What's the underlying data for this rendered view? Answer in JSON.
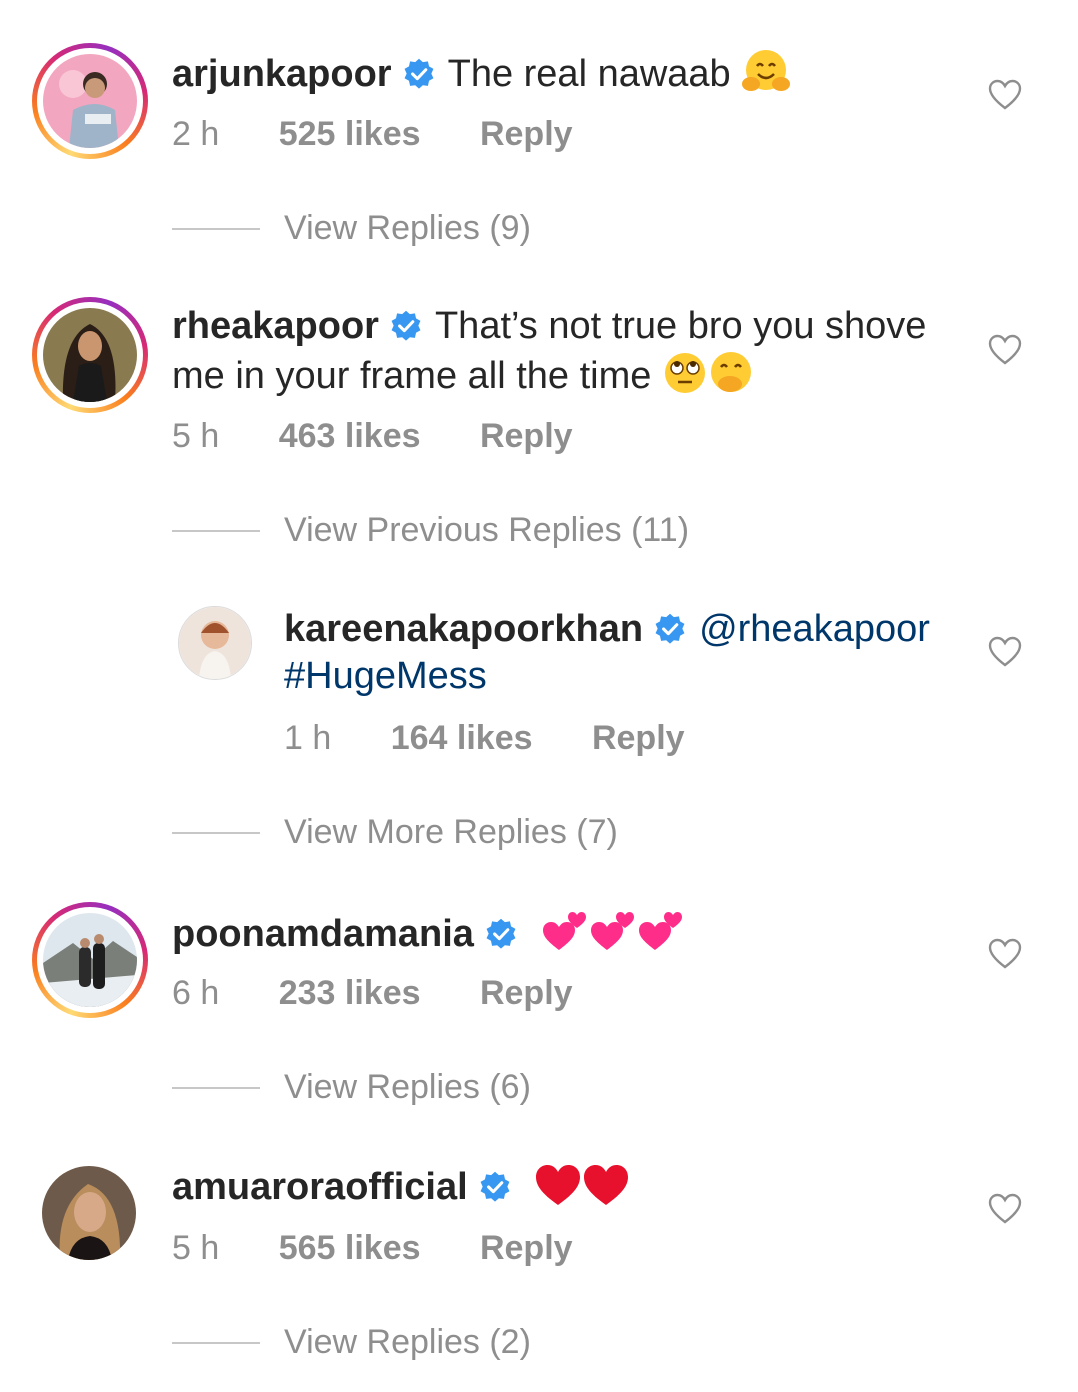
{
  "comments": [
    {
      "username": "arjunkapoor",
      "text": "The real nawaab",
      "time": "2 h",
      "likes": "525 likes",
      "reply": "Reply",
      "replies": "View Replies (9)"
    },
    {
      "username": "rheakapoor",
      "text_line1": "That’s not true bro you shove",
      "text_line2": "me in your frame all the time",
      "time": "5 h",
      "likes": "463 likes",
      "reply": "Reply",
      "replies": "View Previous Replies (11)"
    },
    {
      "username": "kareenakapoorkhan",
      "mention": "@rheakapoor",
      "hashtag": "#HugeMess",
      "time": "1 h",
      "likes": "164 likes",
      "reply": "Reply",
      "replies": "View More Replies (7)"
    },
    {
      "username": "poonamdamania",
      "time": "6 h",
      "likes": "233 likes",
      "reply": "Reply",
      "replies": "View Replies (6)"
    },
    {
      "username": "amuaroraofficial",
      "time": "5 h",
      "likes": "565 likes",
      "reply": "Reply",
      "replies": "View Replies (2)"
    }
  ],
  "colors": {
    "text": "#262626",
    "muted": "#8e8e8e",
    "verified": "#3897f0",
    "mention": "#00376b"
  }
}
